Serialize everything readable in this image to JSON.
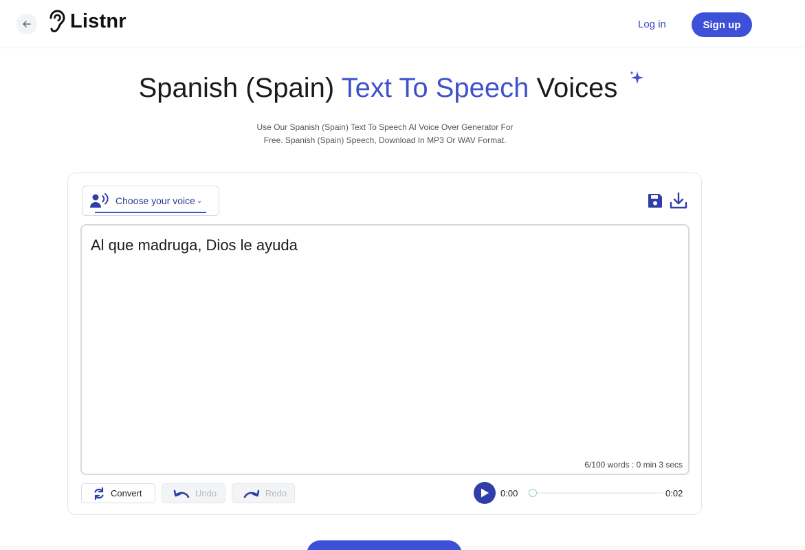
{
  "header": {
    "brand": "Listnr",
    "login_label": "Log in",
    "signup_label": "Sign up"
  },
  "hero": {
    "title_part1": "Spanish (Spain) ",
    "title_accent": "Text To Speech",
    "title_part2": " Voices",
    "subtitle_line1": "Use Our Spanish (Spain) Text To Speech AI Voice Over Generator For",
    "subtitle_line2": "Free. Spanish (Spain) Speech, Download In MP3 Or WAV Format."
  },
  "editor": {
    "voice_select_label": "Choose your voice",
    "text": "Al que madruga, Dios le ayuda",
    "word_count": "6/100 words : 0 min 3 secs"
  },
  "toolbar": {
    "convert_label": "Convert",
    "undo_label": "Undo",
    "redo_label": "Redo"
  },
  "player": {
    "current_time": "0:00",
    "total_time": "0:02",
    "progress": 0
  },
  "colors": {
    "accent": "#3e52cc",
    "primary_button": "#3c50d8",
    "play_button": "#2f3ea8"
  },
  "icons": {
    "back": "arrow-left-icon",
    "logo": "ear-icon",
    "sparkle": "sparkle-icon",
    "voice": "speaker-person-icon",
    "save": "floppy-disk-icon",
    "download": "download-icon",
    "convert": "refresh-icon",
    "undo": "undo-icon",
    "redo": "redo-icon",
    "play": "play-icon"
  }
}
